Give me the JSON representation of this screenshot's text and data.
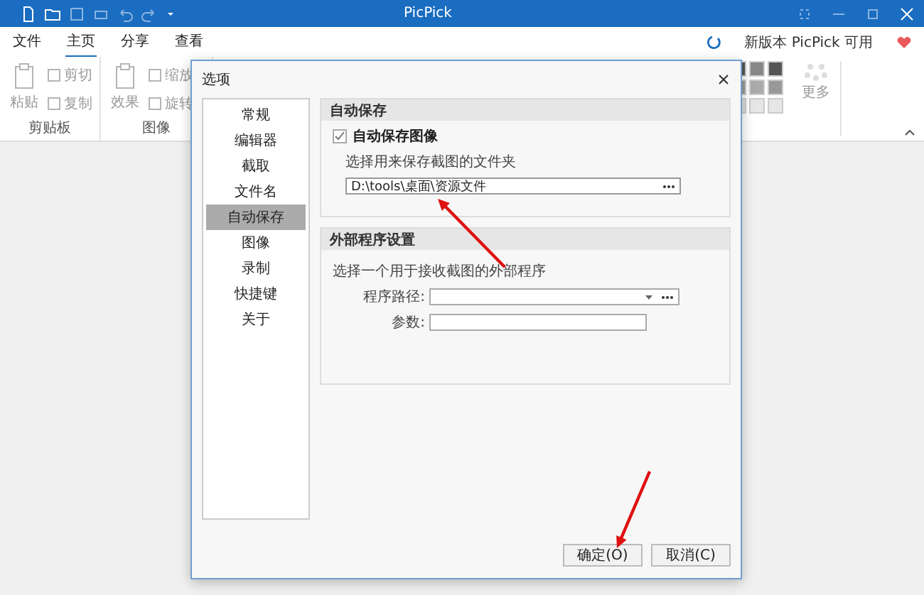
{
  "window": {
    "title": "PicPick"
  },
  "menu_tabs": [
    {
      "label": "文件",
      "selected": false
    },
    {
      "label": "主页",
      "selected": true
    },
    {
      "label": "分享",
      "selected": false
    },
    {
      "label": "查看",
      "selected": false
    }
  ],
  "update_notice": "新版本 PicPick 可用",
  "ribbon": {
    "groups": [
      {
        "label": "剪贴板",
        "buttons": [
          {
            "label": "粘贴",
            "kind": "large",
            "disabled": true
          },
          {
            "label": "剪切",
            "kind": "small",
            "disabled": true
          },
          {
            "label": "复制",
            "kind": "small",
            "disabled": true
          }
        ]
      },
      {
        "label": "图像",
        "buttons": [
          {
            "label": "效果",
            "kind": "large",
            "disabled": true
          },
          {
            "label": "缩放",
            "kind": "menu",
            "disabled": true
          },
          {
            "label": "旋转",
            "kind": "menu",
            "disabled": true
          }
        ]
      }
    ],
    "more": {
      "label": "更多",
      "disabled": true
    }
  },
  "dialog": {
    "title": "选项",
    "nav": [
      {
        "label": "常规",
        "selected": false
      },
      {
        "label": "编辑器",
        "selected": false
      },
      {
        "label": "截取",
        "selected": false
      },
      {
        "label": "文件名",
        "selected": false
      },
      {
        "label": "自动保存",
        "selected": true
      },
      {
        "label": "图像",
        "selected": false
      },
      {
        "label": "录制",
        "selected": false
      },
      {
        "label": "快捷键",
        "selected": false
      },
      {
        "label": "关于",
        "selected": false
      }
    ],
    "autosave": {
      "title": "自动保存",
      "checkbox": {
        "label": "自动保存图像",
        "checked": true
      },
      "folder_label": "选择用来保存截图的文件夹",
      "folder_path": "D:\\tools\\桌面\\资源文件"
    },
    "external": {
      "title": "外部程序设置",
      "description": "选择一个用于接收截图的外部程序",
      "fields": [
        {
          "label": "程序路径:",
          "kind": "dropdown"
        },
        {
          "label": "参数:",
          "kind": "text"
        }
      ]
    },
    "buttons": [
      "确定(O)",
      "取消(C)"
    ]
  }
}
